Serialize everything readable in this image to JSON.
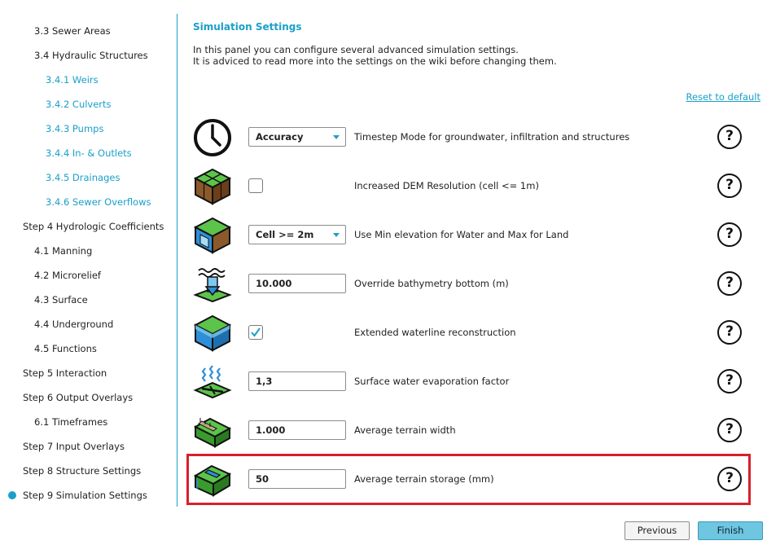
{
  "sidebar": {
    "items": [
      {
        "label": "3.3 Sewer Areas",
        "level": 2
      },
      {
        "label": "3.4 Hydraulic Structures",
        "level": 2
      },
      {
        "label": "3.4.1 Weirs",
        "level": 3
      },
      {
        "label": "3.4.2 Culverts",
        "level": 3
      },
      {
        "label": "3.4.3 Pumps",
        "level": 3
      },
      {
        "label": "3.4.4 In- & Outlets",
        "level": 3
      },
      {
        "label": "3.4.5 Drainages",
        "level": 3
      },
      {
        "label": "3.4.6 Sewer Overflows",
        "level": 3
      },
      {
        "label": "Step 4 Hydrologic Coefficients",
        "level": 1
      },
      {
        "label": "4.1 Manning",
        "level": 2
      },
      {
        "label": "4.2 Microrelief",
        "level": 2
      },
      {
        "label": "4.3 Surface",
        "level": 2
      },
      {
        "label": "4.4 Underground",
        "level": 2
      },
      {
        "label": "4.5 Functions",
        "level": 2
      },
      {
        "label": "Step 5 Interaction",
        "level": 1
      },
      {
        "label": "Step 6 Output Overlays",
        "level": 1
      },
      {
        "label": "6.1 Timeframes",
        "level": 2
      },
      {
        "label": "Step 7 Input Overlays",
        "level": 1
      },
      {
        "label": "Step 8 Structure Settings",
        "level": 1
      },
      {
        "label": "Step 9 Simulation Settings",
        "level": 1,
        "active": true
      }
    ]
  },
  "panel": {
    "title": "Simulation Settings",
    "intro_line1": "In this panel you can configure several advanced simulation settings.",
    "intro_line2": "It is adviced to read more into the settings on the wiki before changing them.",
    "reset_label": "Reset to default"
  },
  "settings": [
    {
      "icon": "clock-icon",
      "control": "dropdown",
      "value": "Accuracy",
      "label": "Timestep Mode for groundwater, infiltration and structures"
    },
    {
      "icon": "dem-grid-icon",
      "control": "checkbox",
      "checked": false,
      "label": "Increased DEM Resolution (cell <= 1m)"
    },
    {
      "icon": "terrain-water-icon",
      "control": "dropdown",
      "value": "Cell >= 2m",
      "label": "Use Min elevation for Water and Max for Land"
    },
    {
      "icon": "bathymetry-icon",
      "control": "text",
      "value": "10.000",
      "label": "Override bathymetry bottom (m)"
    },
    {
      "icon": "waterline-cube-icon",
      "control": "checkbox",
      "checked": true,
      "label": "Extended waterline reconstruction"
    },
    {
      "icon": "evaporation-icon",
      "control": "text",
      "value": "1,3",
      "label": "Surface water evaporation factor"
    },
    {
      "icon": "terrain-width-icon",
      "control": "text",
      "value": "1.000",
      "label": "Average terrain width"
    },
    {
      "icon": "terrain-storage-icon",
      "control": "text",
      "value": "50",
      "label": "Average terrain storage (mm)"
    }
  ],
  "help_glyph": "?",
  "footer": {
    "previous_label": "Previous",
    "finish_label": "Finish"
  },
  "colors": {
    "accent": "#1aa0c8",
    "highlight": "#d8202c",
    "finish_button": "#6ec6e0"
  }
}
